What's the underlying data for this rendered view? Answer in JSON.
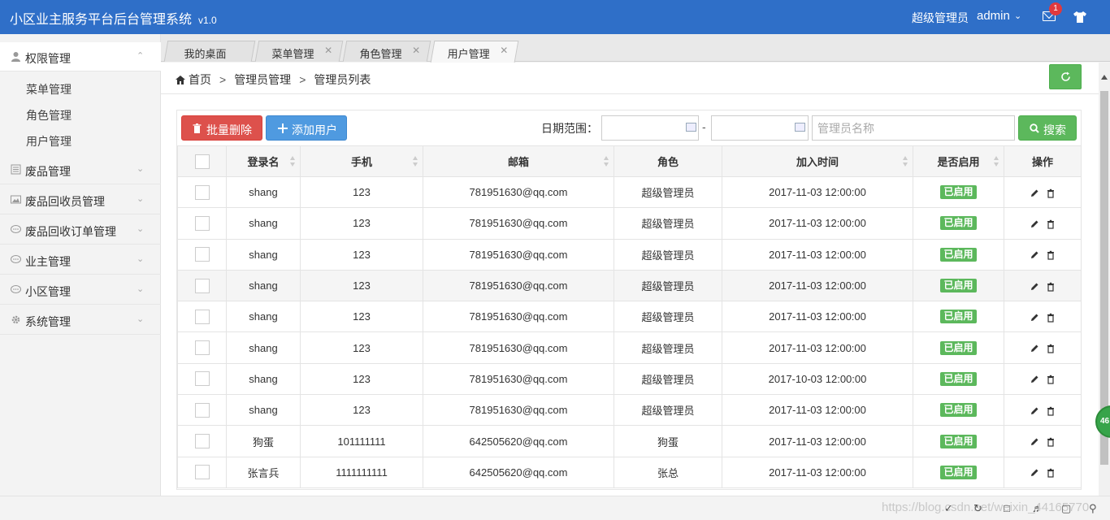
{
  "header": {
    "app_title": "小区业主服务平台后台管理系统",
    "version": "v1.0",
    "user_role": "超级管理员",
    "user_name": "admin",
    "notification_count": "1"
  },
  "sidebar": {
    "groups": [
      {
        "label": "权限管理",
        "icon": "user-icon",
        "expanded": true
      },
      {
        "label": "废品管理",
        "icon": "list-icon"
      },
      {
        "label": "废品回收员管理",
        "icon": "image-icon"
      },
      {
        "label": "废品回收订单管理",
        "icon": "chat-icon"
      },
      {
        "label": "业主管理",
        "icon": "chat-icon"
      },
      {
        "label": "小区管理",
        "icon": "chat-icon"
      },
      {
        "label": "系统管理",
        "icon": "gear-icon"
      }
    ],
    "submenu": [
      {
        "label": "菜单管理"
      },
      {
        "label": "角色管理"
      },
      {
        "label": "用户管理"
      }
    ]
  },
  "tabs": [
    {
      "label": "我的桌面",
      "closable": false
    },
    {
      "label": "菜单管理",
      "closable": true
    },
    {
      "label": "角色管理",
      "closable": true
    },
    {
      "label": "用户管理",
      "closable": true,
      "active": true
    }
  ],
  "breadcrumb": [
    "首页",
    "管理员管理",
    "管理员列表"
  ],
  "toolbar": {
    "batch_delete": "批量删除",
    "add_user": "添加用户",
    "date_range_label": "日期范围：",
    "date_separator": "-",
    "name_placeholder": "管理员名称",
    "search": "搜索"
  },
  "table": {
    "columns": [
      "登录名",
      "手机",
      "邮箱",
      "角色",
      "加入时间",
      "是否启用",
      "操作"
    ],
    "rows": [
      {
        "login": "shang",
        "phone": "123",
        "email": "781951630@qq.com",
        "role": "超级管理员",
        "joined": "2017-11-03 12:00:00",
        "status": "已启用"
      },
      {
        "login": "shang",
        "phone": "123",
        "email": "781951630@qq.com",
        "role": "超级管理员",
        "joined": "2017-11-03 12:00:00",
        "status": "已启用"
      },
      {
        "login": "shang",
        "phone": "123",
        "email": "781951630@qq.com",
        "role": "超级管理员",
        "joined": "2017-11-03 12:00:00",
        "status": "已启用"
      },
      {
        "login": "shang",
        "phone": "123",
        "email": "781951630@qq.com",
        "role": "超级管理员",
        "joined": "2017-11-03 12:00:00",
        "status": "已启用"
      },
      {
        "login": "shang",
        "phone": "123",
        "email": "781951630@qq.com",
        "role": "超级管理员",
        "joined": "2017-11-03 12:00:00",
        "status": "已启用"
      },
      {
        "login": "shang",
        "phone": "123",
        "email": "781951630@qq.com",
        "role": "超级管理员",
        "joined": "2017-11-03 12:00:00",
        "status": "已启用"
      },
      {
        "login": "shang",
        "phone": "123",
        "email": "781951630@qq.com",
        "role": "超级管理员",
        "joined": "2017-10-03 12:00:00",
        "status": "已启用"
      },
      {
        "login": "shang",
        "phone": "123",
        "email": "781951630@qq.com",
        "role": "超级管理员",
        "joined": "2017-11-03 12:00:00",
        "status": "已启用"
      },
      {
        "login": "狗蛋",
        "phone": "101111111",
        "email": "642505620@qq.com",
        "role": "狗蛋",
        "joined": "2017-11-03 12:00:00",
        "status": "已启用"
      },
      {
        "login": "张言兵",
        "phone": "1111111111",
        "email": "642505620@qq.com",
        "role": "张总",
        "joined": "2017-11-03 12:00:00",
        "status": "已启用"
      }
    ]
  },
  "float_ball_text": "46",
  "watermark": "https://blog.csdn.net/weixin_44165770",
  "colors": {
    "header_bg": "#2f6fc8",
    "danger": "#dd514c",
    "primary": "#4f9ae0",
    "success": "#5cb85c"
  }
}
